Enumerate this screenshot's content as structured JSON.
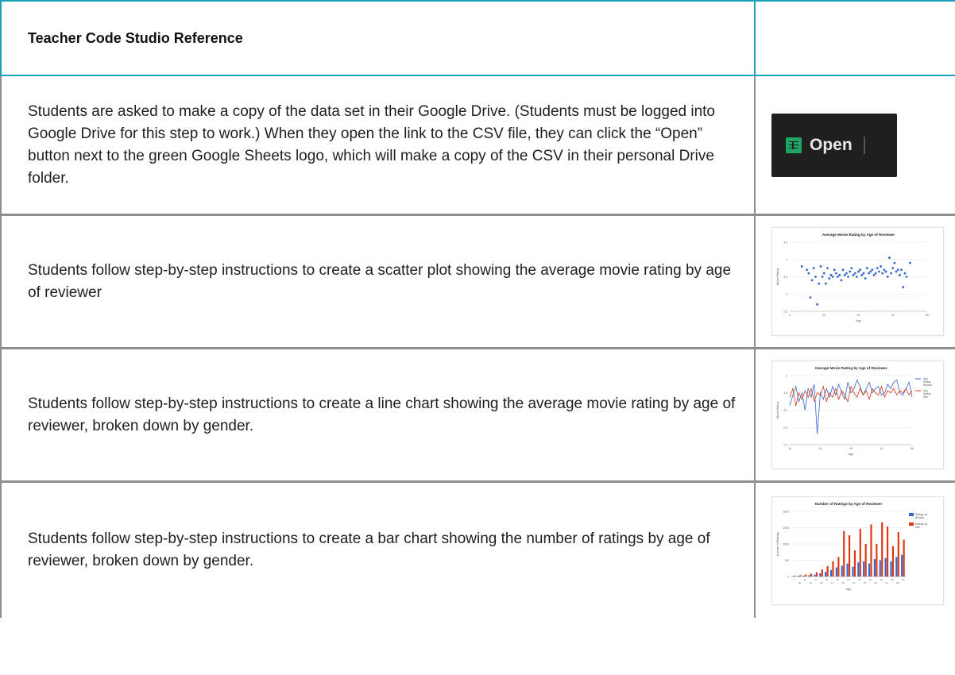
{
  "header": {
    "title": "Teacher Code Studio Reference"
  },
  "rows": [
    {
      "text": "Students are asked to make a copy of the data set in their Google Drive. (Students must be logged into Google Drive for this step to work.) When they open the link to the CSV file, they can click the “Open” button next to the green Google Sheets logo, which will make a copy of the CSV in their personal Drive folder.",
      "image": {
        "button_label": "Open",
        "icon": "google-sheets-icon",
        "background": "#1f1f1f",
        "icon_color": "#1fa463"
      }
    },
    {
      "text": "Students follow step-by-step instructions to create a scatter plot showing the average movie rating by age of reviewer"
    },
    {
      "text": "Students follow step-by-step instructions to create a line chart showing the average movie rating by age of reviewer, broken down by gender."
    },
    {
      "text": "Students follow step-by-step instructions to create a bar chart showing the number of ratings by age of reviewer, broken down by gender."
    }
  ],
  "chart_data": [
    {
      "type": "scatter",
      "title": "Average Movie Rating by Age of Reviewer",
      "xlabel": "Age",
      "ylabel": "Movie Rating",
      "xlim": [
        0,
        80
      ],
      "ylim": [
        2.5,
        4.5
      ],
      "xticks": [
        "0",
        "20",
        "40",
        "60",
        "80"
      ],
      "yticks": [
        "2.5",
        "3",
        "3.5",
        "4",
        "4.5"
      ],
      "color": "#3366cc",
      "x": [
        7,
        10,
        11,
        12,
        13,
        14,
        15,
        16,
        17,
        18,
        19,
        20,
        21,
        22,
        23,
        24,
        25,
        26,
        27,
        28,
        29,
        30,
        31,
        32,
        33,
        34,
        35,
        36,
        37,
        38,
        39,
        40,
        41,
        42,
        43,
        44,
        45,
        46,
        47,
        48,
        49,
        50,
        51,
        52,
        53,
        54,
        55,
        56,
        57,
        58,
        59,
        60,
        61,
        62,
        63,
        64,
        65,
        66,
        67,
        68,
        70
      ],
      "y": [
        3.8,
        3.7,
        3.6,
        2.9,
        3.4,
        3.75,
        3.5,
        2.7,
        3.3,
        3.8,
        3.5,
        3.6,
        3.3,
        3.75,
        3.45,
        3.55,
        3.5,
        3.7,
        3.6,
        3.5,
        3.55,
        3.4,
        3.7,
        3.55,
        3.6,
        3.5,
        3.65,
        3.75,
        3.55,
        3.6,
        3.5,
        3.65,
        3.7,
        3.55,
        3.6,
        3.45,
        3.75,
        3.6,
        3.65,
        3.7,
        3.55,
        3.6,
        3.75,
        3.65,
        3.8,
        3.6,
        3.7,
        3.65,
        3.5,
        4.05,
        3.6,
        3.75,
        3.9,
        3.65,
        3.7,
        3.55,
        3.7,
        3.2,
        3.6,
        3.5,
        3.9
      ]
    },
    {
      "type": "line",
      "title": "Average Movie Rating by Age of Reviewer",
      "xlabel": "Age",
      "ylabel": "Movie Rating",
      "xlim": [
        15,
        55
      ],
      "ylim": [
        2.4,
        4
      ],
      "xticks": [
        "15",
        "25",
        "35",
        "45",
        "55"
      ],
      "yticks": [
        "2.4",
        "2.8",
        "3.2",
        "3.6",
        "4"
      ],
      "legend": "right",
      "x": [
        15,
        16,
        17,
        18,
        19,
        20,
        21,
        22,
        23,
        24,
        25,
        26,
        27,
        28,
        29,
        30,
        31,
        32,
        33,
        34,
        35,
        36,
        37,
        38,
        39,
        40,
        41,
        42,
        43,
        44,
        45,
        46,
        47,
        48,
        49,
        50,
        51,
        52,
        53,
        54,
        55
      ],
      "series": [
        {
          "name": "Avg. Rating Women",
          "color": "#3366cc",
          "values": [
            3.3,
            3.55,
            3.75,
            3.4,
            3.6,
            3.2,
            3.7,
            3.5,
            3.8,
            2.65,
            3.6,
            3.45,
            3.7,
            3.5,
            3.75,
            3.55,
            3.8,
            3.6,
            3.45,
            3.85,
            3.6,
            3.7,
            3.9,
            3.75,
            3.55,
            3.7,
            3.85,
            3.6,
            3.7,
            3.75,
            3.55,
            3.6,
            3.8,
            3.7,
            3.85,
            3.9,
            3.6,
            3.55,
            3.7,
            3.85,
            3.5
          ]
        },
        {
          "name": "Avg. Rating Men",
          "color": "#dc3912",
          "values": [
            3.5,
            3.7,
            3.3,
            3.6,
            3.45,
            3.65,
            3.5,
            3.7,
            3.4,
            3.6,
            3.55,
            3.75,
            3.4,
            3.6,
            3.5,
            3.7,
            3.45,
            3.65,
            3.55,
            3.4,
            3.75,
            3.6,
            3.5,
            3.7,
            3.55,
            3.65,
            3.45,
            3.7,
            3.6,
            3.55,
            3.75,
            3.5,
            3.65,
            3.6,
            3.7,
            3.55,
            3.65,
            3.6,
            3.7,
            3.55,
            3.65
          ]
        }
      ]
    },
    {
      "type": "bar",
      "title": "Number of Ratings by Age of Reviewer",
      "xlabel": "Age",
      "ylabel": "Number of Ratings",
      "ylim": [
        0,
        3000
      ],
      "yticks": [
        "0",
        "750",
        "1500",
        "2250",
        "3000"
      ],
      "legend": "right",
      "categories": [
        "7",
        "10",
        "11",
        "13",
        "14",
        "15",
        "16",
        "17",
        "18",
        "19",
        "20",
        "21",
        "22",
        "23",
        "24",
        "25",
        "26",
        "27",
        "28",
        "29",
        "30"
      ],
      "tick_labels_row1": [
        "7",
        "11",
        "14",
        "16",
        "18",
        "20",
        "22",
        "24",
        "26",
        "28",
        "30"
      ],
      "tick_labels_row2": [
        "10",
        "13",
        "15",
        "17",
        "19",
        "21",
        "23",
        "25",
        "27",
        "29"
      ],
      "series": [
        {
          "name": "Ratings by Women",
          "color": "#3366cc",
          "values": [
            20,
            30,
            40,
            60,
            90,
            150,
            220,
            300,
            420,
            500,
            600,
            450,
            650,
            700,
            600,
            800,
            750,
            850,
            700,
            900,
            1000
          ]
        },
        {
          "name": "Ratings by Men",
          "color": "#dc3912",
          "values": [
            40,
            60,
            90,
            130,
            200,
            330,
            480,
            700,
            900,
            2100,
            1900,
            1200,
            2200,
            1500,
            2400,
            1500,
            2500,
            2300,
            1400,
            2050,
            1700
          ]
        }
      ]
    }
  ]
}
